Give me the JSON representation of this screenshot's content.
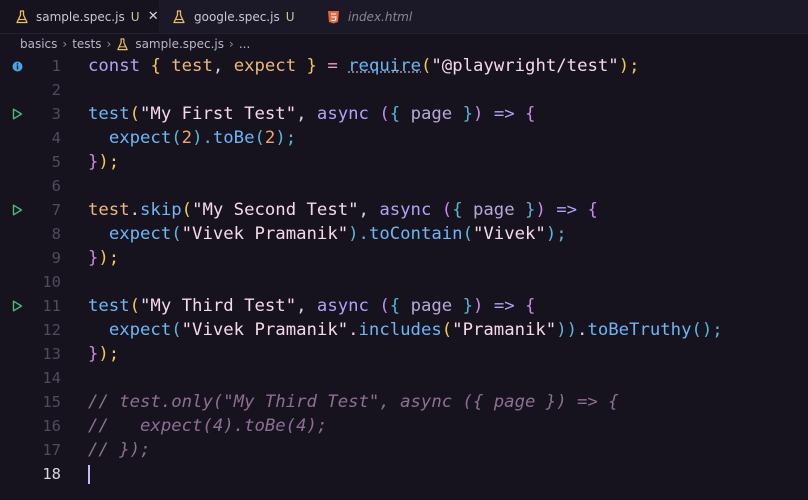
{
  "tabs": [
    {
      "label": "sample.spec.js",
      "badge": "U",
      "close": "✕",
      "active": true,
      "icon": "flask-icon"
    },
    {
      "label": "google.spec.js",
      "badge": "U",
      "active": false,
      "icon": "flask-icon"
    },
    {
      "label": "index.html",
      "active": false,
      "icon": "html5-icon"
    }
  ],
  "breadcrumb": {
    "parts": [
      "basics",
      "tests",
      "sample.spec.js",
      "..."
    ],
    "separator": "›"
  },
  "editor": {
    "lines": [
      {
        "num": "1",
        "marker": "info-icon"
      },
      {
        "num": "2"
      },
      {
        "num": "3",
        "marker": "run-test-icon"
      },
      {
        "num": "4"
      },
      {
        "num": "5"
      },
      {
        "num": "6"
      },
      {
        "num": "7",
        "marker": "run-test-icon"
      },
      {
        "num": "8"
      },
      {
        "num": "9"
      },
      {
        "num": "10"
      },
      {
        "num": "11",
        "marker": "run-test-icon"
      },
      {
        "num": "12"
      },
      {
        "num": "13"
      },
      {
        "num": "14"
      },
      {
        "num": "15"
      },
      {
        "num": "16"
      },
      {
        "num": "17"
      },
      {
        "num": "18",
        "current": true
      }
    ],
    "tokens": {
      "l1": [
        "const",
        " ",
        "{",
        " ",
        "test",
        ", ",
        "expect",
        " ",
        "}",
        " = ",
        "require",
        "(",
        "\"@playwright/test\"",
        ");"
      ],
      "l3": [
        "test",
        "(",
        "\"My First Test\"",
        ", ",
        "async",
        " (",
        "{",
        " ",
        "page",
        " ",
        "}",
        ") ",
        "=>",
        " {"
      ],
      "l4": [
        "  ",
        "expect",
        "(",
        "2",
        ").",
        "toBe",
        "(",
        "2",
        ");"
      ],
      "l5": [
        "}",
        ");"
      ],
      "l7": [
        "test",
        ".",
        "skip",
        "(",
        "\"My Second Test\"",
        ", ",
        "async",
        " (",
        "{",
        " ",
        "page",
        " ",
        "}",
        ") ",
        "=>",
        " {"
      ],
      "l8": [
        "  ",
        "expect",
        "(",
        "\"Vivek Pramanik\"",
        ").",
        "toContain",
        "(",
        "\"Vivek\"",
        ");"
      ],
      "l9": [
        "}",
        ");"
      ],
      "l11": [
        "test",
        "(",
        "\"My Third Test\"",
        ", ",
        "async",
        " (",
        "{",
        " ",
        "page",
        " ",
        "}",
        ") ",
        "=>",
        " {"
      ],
      "l12": [
        "  ",
        "expect",
        "(",
        "\"Vivek Pramanik\"",
        ".",
        "includes",
        "(",
        "\"Pramanik\"",
        "))",
        ".",
        "toBeTruthy",
        "();"
      ],
      "l13": [
        "}",
        ");"
      ],
      "l15": "// test.only(\"My Third Test\", async ({ page }) => {",
      "l16": "//   expect(4).toBe(4);",
      "l17": "// });"
    }
  },
  "colors": {
    "background": "#16131f",
    "keyword": "#b4a2f5",
    "function": "#6cb6f4",
    "string": "#f5d9e8",
    "number": "#f2a66a",
    "comment": "#8d6f93",
    "run_marker": "#3fc07a",
    "info_marker": "#4aa3e8"
  }
}
